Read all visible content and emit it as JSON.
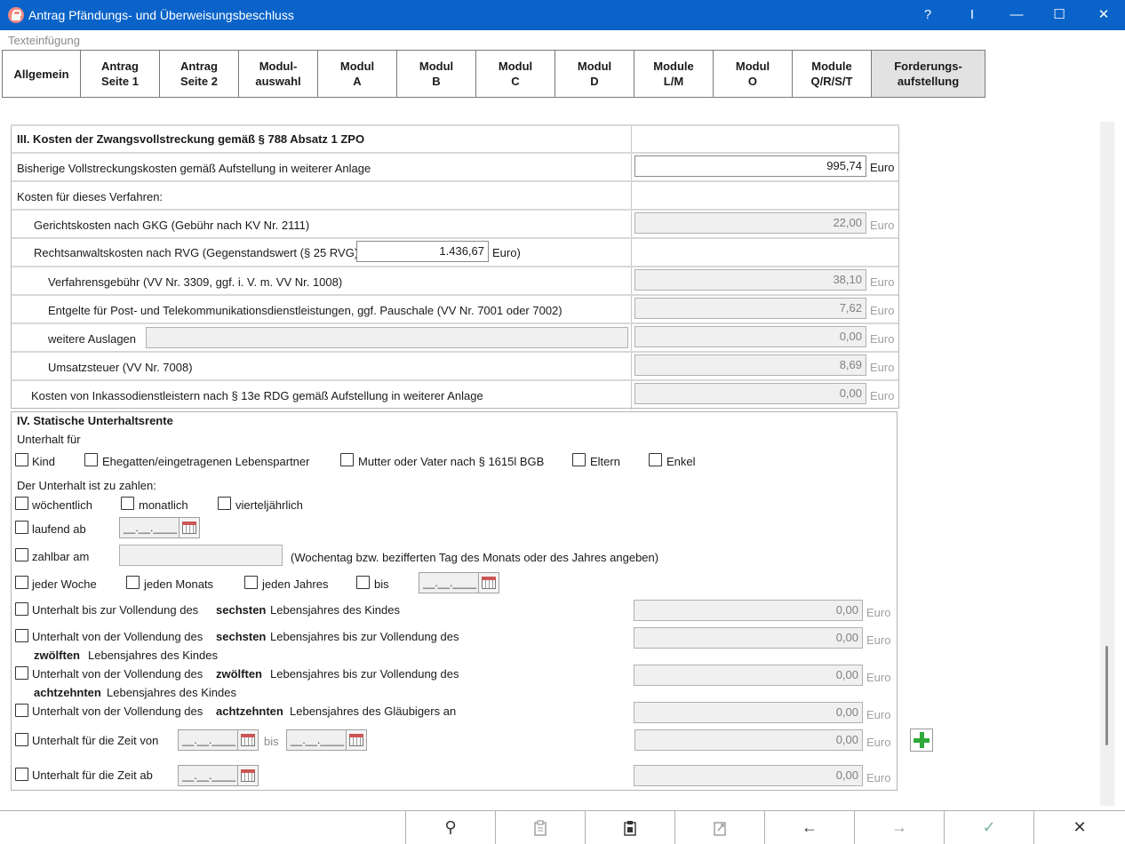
{
  "window": {
    "title": "Antrag Pfändungs- und Überweisungsbeschluss",
    "help": "?",
    "cursor": "I",
    "minimize": "—",
    "maximize": "☐",
    "close": "✕"
  },
  "subheader": "Texteinfügung",
  "tabs": [
    {
      "label": "Allgemein"
    },
    {
      "label": "Antrag\nSeite 1"
    },
    {
      "label": "Antrag\nSeite 2"
    },
    {
      "label": "Modul-\nauswahl"
    },
    {
      "label": "Modul\nA"
    },
    {
      "label": "Modul\nB"
    },
    {
      "label": "Modul\nC"
    },
    {
      "label": "Modul\nD"
    },
    {
      "label": "Module\nL/M"
    },
    {
      "label": "Modul\nO"
    },
    {
      "label": "Module\nQ/R/S/T"
    },
    {
      "label": "Forderungs-\naufstellung"
    }
  ],
  "section3": {
    "heading": "III.  Kosten der Zwangsvollstreckung gemäß § 788 Absatz 1 ZPO",
    "bisherige_label": "Bisherige Vollstreckungskosten gemäß Aufstellung in weiterer Anlage",
    "bisherige_value": "995,74",
    "unit": "Euro",
    "verfahren_label": "Kosten für dieses Verfahren:",
    "gkg_label": "Gerichtskosten nach GKG (Gebühr nach KV Nr. 2111)",
    "gkg_value": "22,00",
    "rvg_label": "Rechtsanwaltskosten nach RVG (Gegenstandswert (§ 25 RVG):",
    "rvg_value": "1.436,67",
    "rvg_unit": "Euro)",
    "verfahrensgebuehr_label": "Verfahrensgebühr (VV Nr. 3309, ggf. i. V. m. VV Nr. 1008)",
    "verfahrensgebuehr_value": "38,10",
    "entgelte_label": "Entgelte für Post- und Telekommunikationsdienstleistungen, ggf. Pauschale (VV Nr. 7001 oder 7002)",
    "entgelte_value": "7,62",
    "auslagen_label": "weitere Auslagen",
    "auslagen_text": "",
    "auslagen_value": "0,00",
    "umsatzsteuer_label": "Umsatzsteuer (VV Nr. 7008)",
    "umsatzsteuer_value": "8,69",
    "inkasso_label": "Kosten von Inkassodienstleistern nach § 13e RDG gemäß Aufstellung in weiterer Anlage",
    "inkasso_value": "0,00"
  },
  "section4": {
    "heading": "IV. Statische Unterhaltsrente",
    "unterhalt_fuer": "Unterhalt für",
    "kind": "Kind",
    "ehegatten": "Ehegatten/eingetragenen Lebenspartner",
    "mutter": "Mutter oder Vater nach § 1615l BGB",
    "eltern": "Eltern",
    "enkel": "Enkel",
    "zu_zahlen": "Der Unterhalt ist zu zahlen:",
    "woechentlich": "wöchentlich",
    "monatlich": "monatlich",
    "vierteljaehrlich": "vierteljährlich",
    "laufend_ab": "laufend ab",
    "date_placeholder": "__.__.____",
    "zahlbar_am": "zahlbar am",
    "zahlbar_hint": "(Wochentag bzw. bezifferten Tag des Monats oder des Jahres angeben)",
    "jeder_woche": "jeder Woche",
    "jeden_monats": "jeden Monats",
    "jeden_jahres": "jeden Jahres",
    "bis": "bis",
    "r1_a": "Unterhalt bis zur Vollendung des",
    "r1_b": "sechsten",
    "r1_c": "Lebensjahres des Kindes",
    "r2_a": "Unterhalt von der Vollendung des",
    "r2_b": "sechsten",
    "r2_c": "Lebensjahres bis zur Vollendung des",
    "r2_d": "zwölften",
    "r2_e": "Lebensjahres des Kindes",
    "r3_a": "Unterhalt von der Vollendung des",
    "r3_b": "zwölften",
    "r3_c": "Lebensjahres bis zur Vollendung des",
    "r3_d": "achtzehnten",
    "r3_e": "Lebensjahres des Kindes",
    "r4_a": "Unterhalt von der Vollendung des",
    "r4_b": "achtzehnten",
    "r4_c": "Lebensjahres des Gläubigers an",
    "zeit_von": "Unterhalt für die Zeit von",
    "zeit_ab": "Unterhalt für die Zeit ab",
    "zero": "0,00",
    "unit": "Euro"
  },
  "bottombar": {
    "search": "⚲",
    "back": "←",
    "forward": "→",
    "ok": "✓",
    "cancel": "✕"
  }
}
